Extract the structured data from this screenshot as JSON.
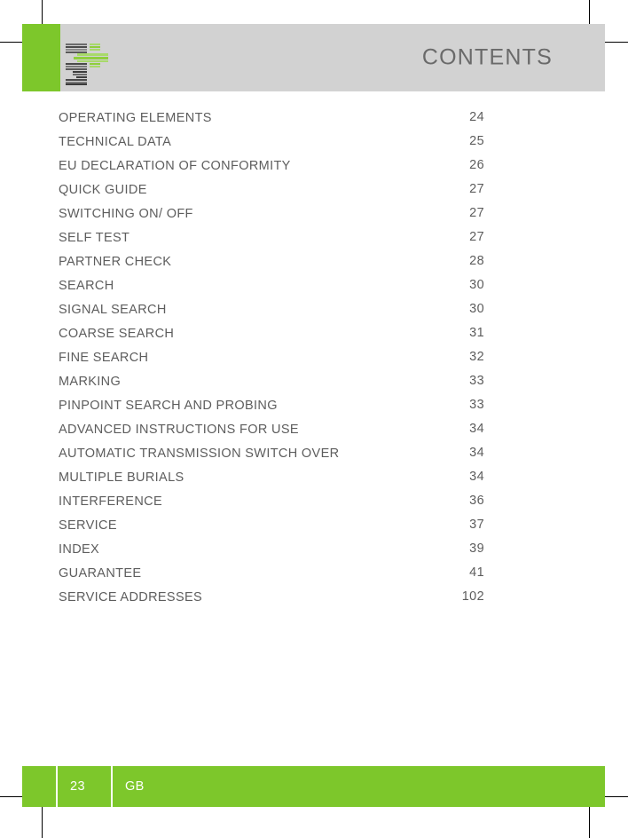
{
  "page": {
    "background_color": "#ffffff",
    "accent_green": "#7dc72b",
    "header_gray": "#d2d2d2",
    "text_gray": "#5d5d5d"
  },
  "header": {
    "title": "CONTENTS",
    "logo_name": "stacked-bars-logo"
  },
  "contents": {
    "entries": [
      {
        "label": "OPERATING ELEMENTS",
        "page": "24"
      },
      {
        "label": "TECHNICAL DATA",
        "page": "25"
      },
      {
        "label": "EU DECLARATION OF CONFORMITY",
        "page": "26"
      },
      {
        "label": "QUICK GUIDE",
        "page": "27"
      },
      {
        "label": "SWITCHING ON/ OFF",
        "page": "27"
      },
      {
        "label": "SELF TEST",
        "page": "27"
      },
      {
        "label": "PARTNER CHECK",
        "page": "28"
      },
      {
        "label": "SEARCH",
        "page": "30"
      },
      {
        "label": "SIGNAL SEARCH",
        "page": "30"
      },
      {
        "label": "COARSE SEARCH",
        "page": "31"
      },
      {
        "label": "FINE SEARCH",
        "page": "32"
      },
      {
        "label": "MARKING",
        "page": "33"
      },
      {
        "label": "PINPOINT SEARCH AND PROBING",
        "page": "33"
      },
      {
        "label": "ADVANCED INSTRUCTIONS FOR USE",
        "page": "34"
      },
      {
        "label": "AUTOMATIC TRANSMISSION SWITCH OVER",
        "page": "34"
      },
      {
        "label": "MULTIPLE BURIALS",
        "page": "34"
      },
      {
        "label": "INTERFERENCE",
        "page": "36"
      },
      {
        "label": "SERVICE",
        "page": "37"
      },
      {
        "label": "INDEX",
        "page": "39"
      },
      {
        "label": "GUARANTEE",
        "page": "41"
      },
      {
        "label": "SERVICE ADDRESSES",
        "page": "102"
      }
    ]
  },
  "footer": {
    "page_number": "23",
    "language_code": "GB"
  }
}
